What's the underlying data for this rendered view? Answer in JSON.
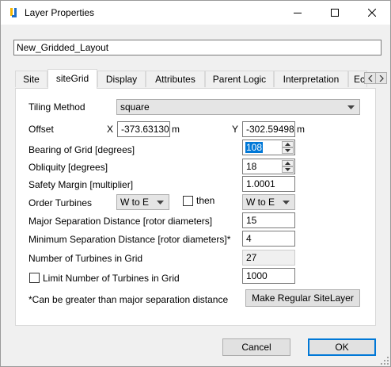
{
  "window": {
    "title": "Layer Properties"
  },
  "layer_name": "New_Gridded_Layout",
  "tabs": [
    {
      "label": "Site"
    },
    {
      "label": "siteGrid"
    },
    {
      "label": "Display"
    },
    {
      "label": "Attributes"
    },
    {
      "label": "Parent Logic"
    },
    {
      "label": "Interpretation"
    },
    {
      "label": "Ec"
    }
  ],
  "grid": {
    "tiling_method_label": "Tiling Method",
    "tiling_method_value": "square",
    "offset_label": "Offset",
    "offset_x_label": "X",
    "offset_x_value": "-373.631303",
    "offset_x_unit": "m",
    "offset_y_label": "Y",
    "offset_y_value": "-302.594980",
    "offset_y_unit": "m",
    "bearing_label": "Bearing of Grid [degrees]",
    "bearing_value": "108",
    "obliquity_label": "Obliquity [degrees]",
    "obliquity_value": "18",
    "safety_margin_label": "Safety Margin [multiplier]",
    "safety_margin_value": "1.0001",
    "order_turbines_label": "Order Turbines",
    "order_first_value": "W to E",
    "then_label": "then",
    "order_second_value": "W to E",
    "major_sep_label": "Major Separation Distance [rotor diameters]",
    "major_sep_value": "15",
    "min_sep_label": "Minimum Separation Distance [rotor diameters]*",
    "min_sep_value": "4",
    "num_turbines_label": "Number of Turbines in Grid",
    "num_turbines_value": "27",
    "limit_label": "Limit Number of Turbines in Grid",
    "limit_value": "1000",
    "footnote": "*Can be greater than major separation distance",
    "make_regular_label": "Make Regular SiteLayer"
  },
  "buttons": {
    "cancel": "Cancel",
    "ok": "OK"
  },
  "colors": {
    "accent": "#0078d7",
    "icon_yellow": "#f2b600",
    "icon_blue": "#1e6fc8"
  }
}
